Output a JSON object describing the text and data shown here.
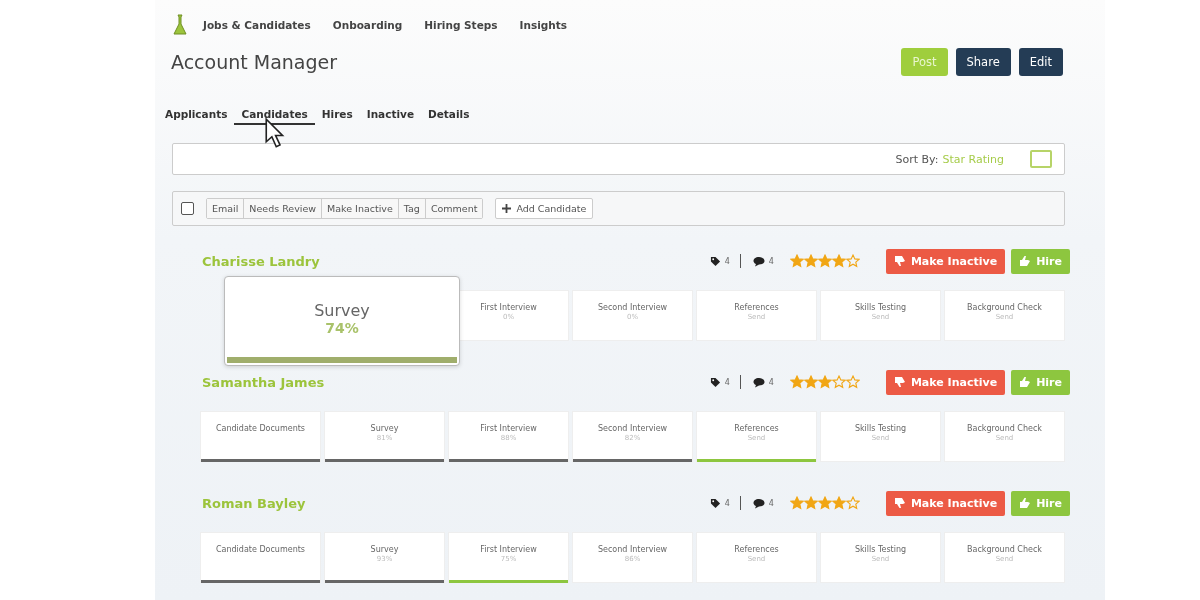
{
  "nav": {
    "items": [
      {
        "label": "Jobs & Candidates"
      },
      {
        "label": "Onboarding"
      },
      {
        "label": "Hiring Steps"
      },
      {
        "label": "Insights"
      }
    ]
  },
  "header": {
    "title": "Account Manager",
    "buttons": [
      {
        "label": "Post",
        "kind": "primary"
      },
      {
        "label": "Share",
        "kind": "dark"
      },
      {
        "label": "Edit",
        "kind": "dark"
      }
    ]
  },
  "tabs": [
    {
      "label": "Applicants",
      "selected": false
    },
    {
      "label": "Candidates",
      "selected": true
    },
    {
      "label": "Hires",
      "selected": false
    },
    {
      "label": "Inactive",
      "selected": false
    },
    {
      "label": "Details",
      "selected": false
    }
  ],
  "sort": {
    "label": "Sort By:",
    "value": "Star Rating"
  },
  "toolbar": {
    "select_all": {
      "checked": false
    },
    "actions": [
      "Email",
      "Needs Review",
      "Make Inactive",
      "Tag",
      "Comment"
    ],
    "add_button": "Add Candidate"
  },
  "candidates": [
    {
      "name": "Charisse Landry",
      "tags": "4",
      "comments": "4",
      "stars": 4,
      "inactive_button": "Make Inactive",
      "hire_button": "Hire",
      "popup": {
        "title": "Survey",
        "value": "74%",
        "level": 1
      },
      "stages": [
        {
          "name": "First Interview",
          "value": "0%",
          "completed": false,
          "active": false
        },
        {
          "name": "Second Interview",
          "value": "0%",
          "completed": false,
          "active": false
        },
        {
          "name": "References",
          "value": "Send",
          "completed": false,
          "active": false
        },
        {
          "name": "Skills Testing",
          "value": "Send",
          "completed": false,
          "active": false
        },
        {
          "name": "Background Check",
          "value": "Send",
          "completed": false,
          "active": false
        }
      ]
    },
    {
      "name": "Samantha James",
      "tags": "4",
      "comments": "4",
      "stars": 3,
      "inactive_button": "Make Inactive",
      "hire_button": "Hire",
      "stages": [
        {
          "name": "Candidate Documents",
          "completed": true,
          "active": false
        },
        {
          "name": "Survey",
          "value": "81%",
          "completed": true,
          "active": false
        },
        {
          "name": "First Interview",
          "value": "88%",
          "completed": true,
          "active": false
        },
        {
          "name": "Second Interview",
          "value": "82%",
          "completed": true,
          "active": false
        },
        {
          "name": "References",
          "value": "Send",
          "completed": false,
          "active": true
        },
        {
          "name": "Skills Testing",
          "value": "Send",
          "completed": false,
          "active": false
        },
        {
          "name": "Background Check",
          "value": "Send",
          "completed": false,
          "active": false
        }
      ]
    },
    {
      "name": "Roman Bayley",
      "tags": "4",
      "comments": "4",
      "stars": 4,
      "inactive_button": "Make Inactive",
      "hire_button": "Hire",
      "stages": [
        {
          "name": "Candidate Documents",
          "completed": true,
          "active": false
        },
        {
          "name": "Survey",
          "value": "93%",
          "completed": true,
          "active": false
        },
        {
          "name": "First Interview",
          "value": "75%",
          "completed": false,
          "active": true
        },
        {
          "name": "Second Interview",
          "value": "86%",
          "completed": false,
          "active": false
        },
        {
          "name": "References",
          "value": "Send",
          "completed": false,
          "active": false
        },
        {
          "name": "Skills Testing",
          "value": "Send",
          "completed": false,
          "active": false
        },
        {
          "name": "Background Check",
          "value": "Send",
          "completed": false,
          "active": false
        }
      ]
    }
  ]
}
